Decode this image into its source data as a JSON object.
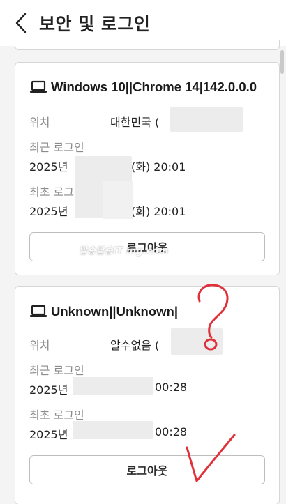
{
  "header": {
    "title": "보안 및 로그인"
  },
  "sessions": [
    {
      "device": "Windows 10||Chrome 14|142.0.0.0",
      "location_label": "위치",
      "location_value": "대한민국 (",
      "recent_label": "최근 로그인",
      "recent_year": "2025년",
      "recent_time": "(화) 20:01",
      "first_label": "최초 로그",
      "first_year": "2025년",
      "first_time": "(화) 20:01",
      "logout_label": "로그아웃"
    },
    {
      "device": "Unknown||Unknown|",
      "location_label": "위치",
      "location_value": "알수없음 (",
      "recent_label": "최근 로그인",
      "recent_year": "2025년",
      "recent_time": "00:28",
      "first_label": "최초 로그인",
      "first_year": "2025년",
      "first_time": "00:28",
      "logout_label": "로그아웃"
    }
  ],
  "watermark": "알송달송IT ing.com",
  "annotations": {
    "question_mark_color": "#e0303a",
    "checkmark_color": "#e0303a"
  },
  "icons": {
    "back": "chevron-left-icon",
    "device": "laptop-icon"
  }
}
